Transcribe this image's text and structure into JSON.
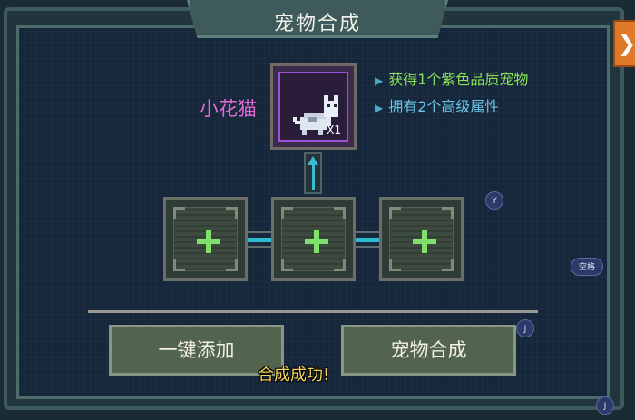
{
  "window": {
    "title": "宠物合成",
    "close_glyph": "❯"
  },
  "result": {
    "pet_name": "小花猫",
    "count_label": "X1"
  },
  "info": [
    {
      "text": "获得1个紫色品质宠物"
    },
    {
      "text": "拥有2个高级属性"
    }
  ],
  "slots": [
    {
      "glyph": "+"
    },
    {
      "glyph": "+"
    },
    {
      "glyph": "+"
    }
  ],
  "buttons": {
    "quick_add": "一键添加",
    "combine": "宠物合成"
  },
  "key_hints": {
    "y": "Y",
    "space": "空格",
    "j1": "J",
    "j2": "J"
  },
  "toast": "合成成功!",
  "colors": {
    "accent": "#39bcd0",
    "purple_quality": "#9b52d8",
    "pet_name": "#e26ad6",
    "info_green": "#8be05a",
    "info_blue": "#6bc4e6",
    "toast": "#f2d25a"
  }
}
